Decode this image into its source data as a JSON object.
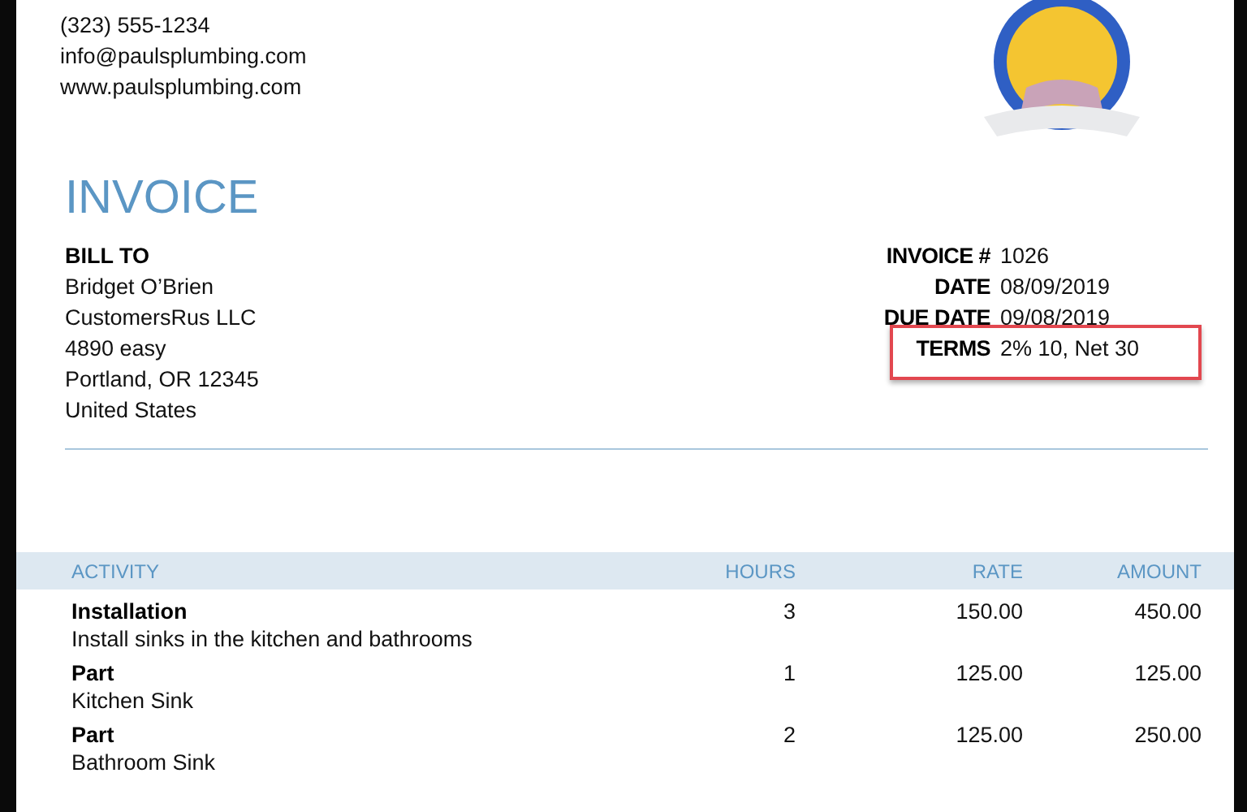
{
  "company": {
    "lines": [
      "(323) 555-1234",
      "info@paulsplumbing.com",
      "www.paulsplumbing.com"
    ]
  },
  "title": "INVOICE",
  "bill_to": {
    "heading": "BILL TO",
    "lines": [
      "Bridget O’Brien",
      "CustomersRus LLC",
      "4890 easy",
      "Portland, OR  12345",
      "United States"
    ]
  },
  "meta": [
    {
      "label": "INVOICE #",
      "value": "1026",
      "highlighted": false
    },
    {
      "label": "DATE",
      "value": "08/09/2019",
      "highlighted": false
    },
    {
      "label": "DUE DATE",
      "value": "09/08/2019",
      "highlighted": false
    },
    {
      "label": "TERMS",
      "value": "2% 10, Net 30",
      "highlighted": true
    }
  ],
  "table": {
    "columns": [
      "ACTIVITY",
      "HOURS",
      "RATE",
      "AMOUNT"
    ],
    "rows": [
      {
        "activity": "Installation",
        "description": "Install sinks in the kitchen and bathrooms",
        "hours": "3",
        "rate": "150.00",
        "amount": "450.00"
      },
      {
        "activity": "Part",
        "description": "Kitchen Sink",
        "hours": "1",
        "rate": "125.00",
        "amount": "125.00"
      },
      {
        "activity": "Part",
        "description": "Bathroom Sink",
        "hours": "2",
        "rate": "125.00",
        "amount": "250.00"
      }
    ]
  }
}
